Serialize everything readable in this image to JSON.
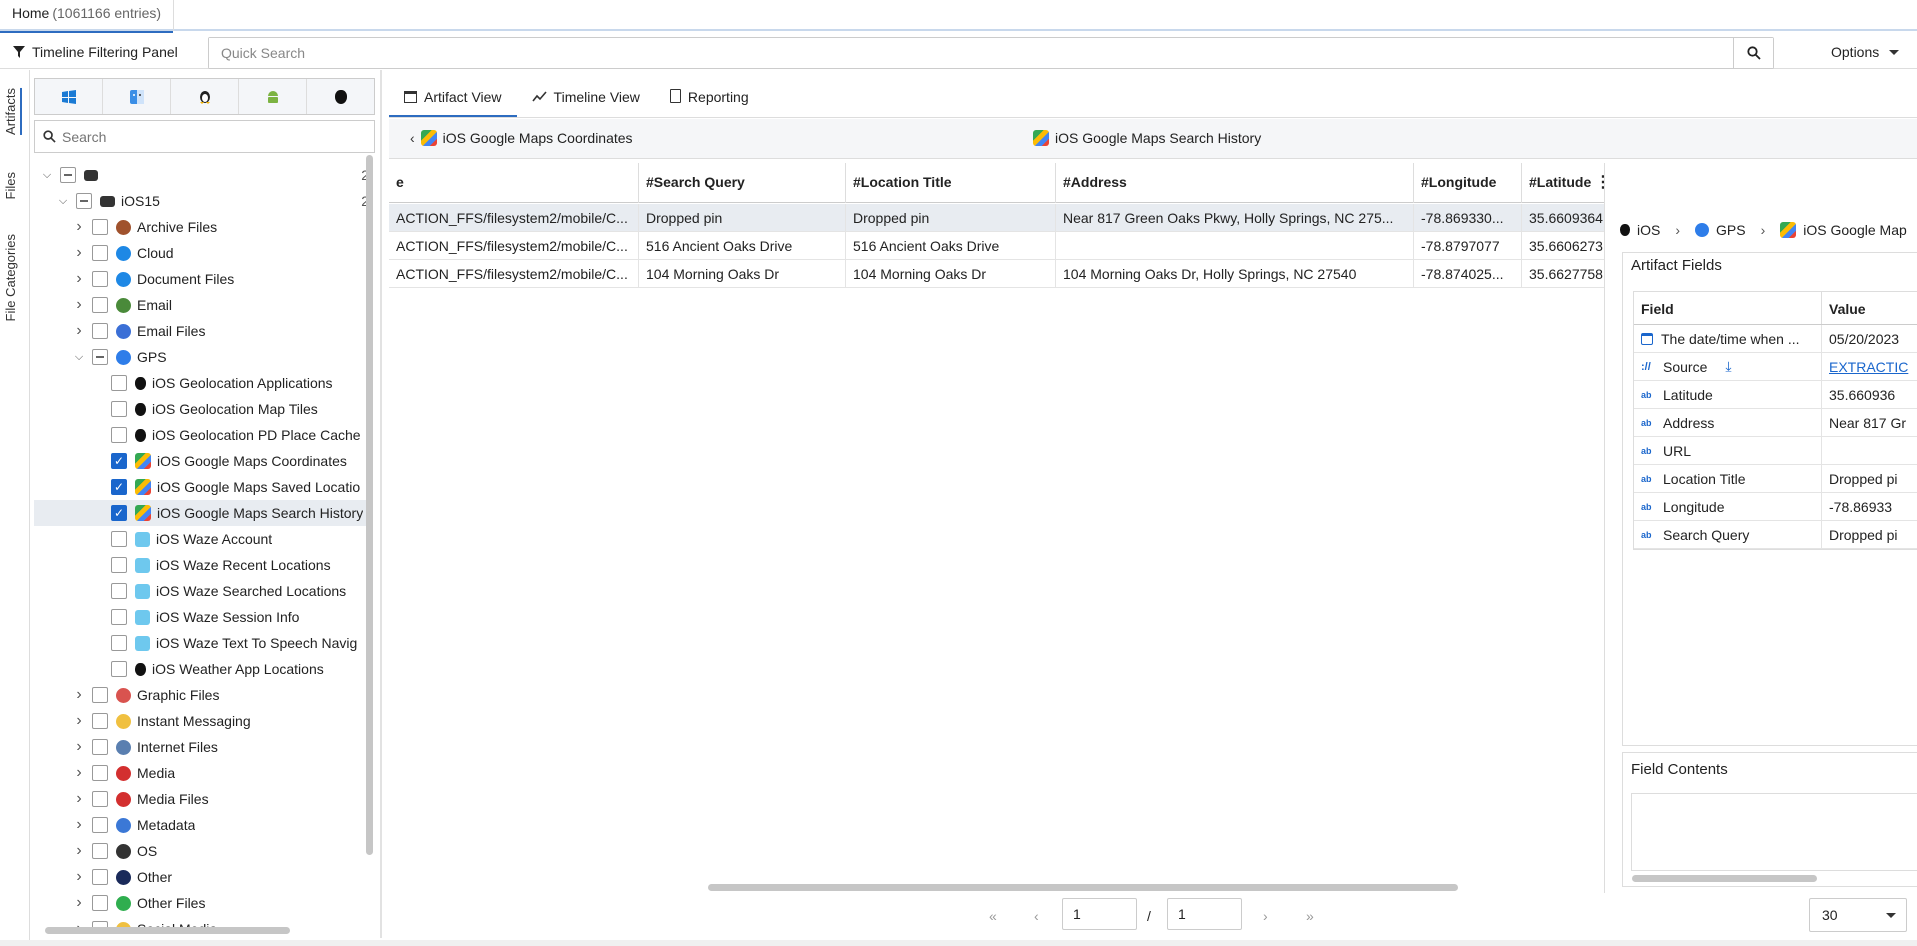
{
  "tabs": {
    "home_label": "Home",
    "home_count": "(1061166 entries)"
  },
  "toolbar": {
    "filter_panel_label": "Timeline Filtering Panel",
    "search_placeholder": "Quick Search",
    "options_label": "Options"
  },
  "rail": {
    "artifacts": "Artifacts",
    "files": "Files",
    "file_categories": "File Categories"
  },
  "left": {
    "search_placeholder": "Search",
    "os_buttons": [
      "windows-icon",
      "finder-icon",
      "linux-icon",
      "android-icon",
      "apple-icon"
    ],
    "root_count": "2",
    "ios15_label": "iOS15",
    "ios15_count": "2",
    "categories": [
      "Archive Files",
      "Cloud",
      "Document Files",
      "Email",
      "Email Files",
      "GPS"
    ],
    "gps_children": [
      "iOS Geolocation Applications",
      "iOS Geolocation Map Tiles",
      "iOS Geolocation PD Place Cache",
      "iOS Google Maps Coordinates",
      "iOS Google Maps Saved Locatio",
      "iOS Google Maps Search History",
      "iOS Waze Account",
      "iOS Waze Recent Locations",
      "iOS Waze Searched Locations",
      "iOS Waze Session Info",
      "iOS Waze Text To Speech Navig",
      "iOS Weather App Locations"
    ],
    "more_categories": [
      "Graphic Files",
      "Instant Messaging",
      "Internet Files",
      "Media",
      "Media Files",
      "Metadata",
      "OS",
      "Other",
      "Other Files",
      "Social Media"
    ]
  },
  "views": {
    "artifact": "Artifact View",
    "timeline": "Timeline View",
    "reporting": "Reporting"
  },
  "breadcrumb": {
    "prev": "iOS Google Maps Coordinates",
    "current": "iOS Google Maps Search History"
  },
  "grid": {
    "headers": [
      "e",
      "#Search Query",
      "#Location Title",
      "#Address",
      "#Longitude",
      "#Latitude"
    ],
    "rows": [
      [
        "ACTION_FFS/filesystem2/mobile/C...",
        "Dropped pin",
        "Dropped pin",
        "Near 817 Green Oaks Pkwy, Holly Springs, NC 275...",
        "-78.869330...",
        "35.6609364"
      ],
      [
        "ACTION_FFS/filesystem2/mobile/C...",
        "516 Ancient Oaks Drive",
        "516 Ancient Oaks Drive",
        "",
        "-78.8797077",
        "35.6606273"
      ],
      [
        "ACTION_FFS/filesystem2/mobile/C...",
        "104 Morning Oaks Dr",
        "104 Morning Oaks Dr",
        "104 Morning Oaks Dr, Holly Springs, NC 27540",
        "-78.874025...",
        "35.6627758"
      ]
    ]
  },
  "pager": {
    "page": "1",
    "slash": "/",
    "total": "1",
    "per_page": "30"
  },
  "right": {
    "crumbs": [
      "iOS",
      "GPS",
      "iOS Google Map"
    ],
    "artifact_fields_title": "Artifact Fields",
    "field_header": "Field",
    "value_header": "Value",
    "fields": [
      {
        "name": "The date/time when ...",
        "value": "05/20/2023",
        "icon": "calendar-icon"
      },
      {
        "name": "Source",
        "value": "EXTRACTIC",
        "icon": "source-icon"
      },
      {
        "name": "Latitude",
        "value": "35.660936",
        "icon": "ab-icon"
      },
      {
        "name": "Address",
        "value": "Near 817 Gr",
        "icon": "ab-icon"
      },
      {
        "name": "URL",
        "value": "",
        "icon": "ab-icon"
      },
      {
        "name": "Location Title",
        "value": "Dropped pi",
        "icon": "ab-icon"
      },
      {
        "name": "Longitude",
        "value": "-78.86933",
        "icon": "ab-icon"
      },
      {
        "name": "Search Query",
        "value": "Dropped pi",
        "icon": "ab-icon"
      }
    ],
    "field_contents_title": "Field Contents"
  }
}
